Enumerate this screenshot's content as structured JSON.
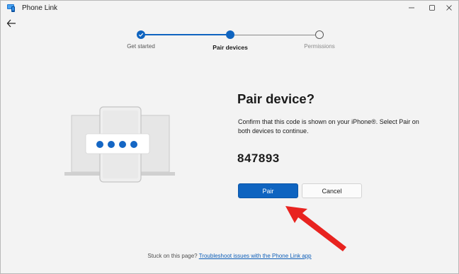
{
  "window": {
    "title": "Phone Link",
    "app_icon": "phone-link-icon",
    "controls": [
      "minimize-icon",
      "maximize-icon",
      "close-icon"
    ]
  },
  "back_icon": "back-arrow-icon",
  "stepper": {
    "steps": [
      {
        "label": "Get started",
        "state": "completed"
      },
      {
        "label": "Pair devices",
        "state": "current"
      },
      {
        "label": "Permissions",
        "state": "upcoming"
      }
    ]
  },
  "illustration": {
    "name": "devices-with-code-illustration",
    "dots": 4
  },
  "main": {
    "heading": "Pair device?",
    "description": "Confirm that this code is shown on your iPhone®. Select Pair on both devices to continue.",
    "code": "847893",
    "pair_label": "Pair",
    "cancel_label": "Cancel"
  },
  "footer": {
    "text": "Stuck on this page?",
    "link": "Troubleshoot issues with the Phone Link app"
  },
  "colors": {
    "accent": "#0f64c0",
    "background": "#f3f3f3",
    "annotation_arrow": "#e8231f"
  }
}
